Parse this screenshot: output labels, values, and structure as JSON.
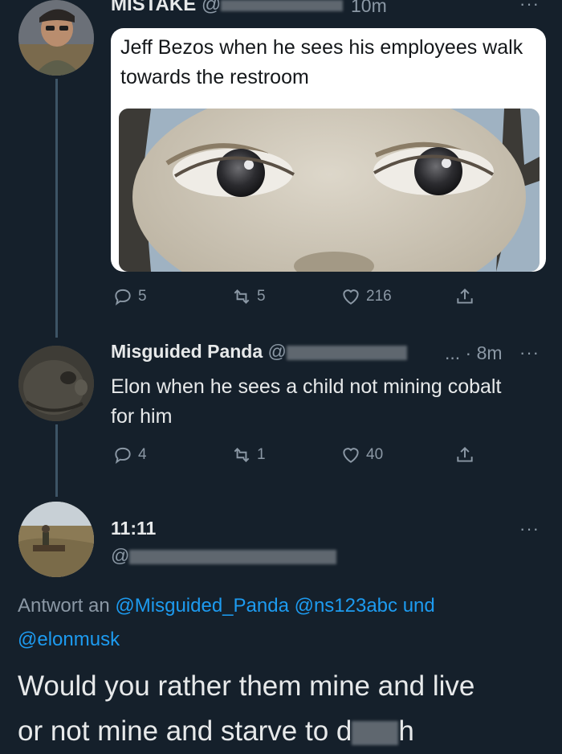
{
  "tweets": [
    {
      "name": "MISTAKE",
      "handle": "@",
      "time": "10m",
      "more": "···",
      "caption": "Jeff Bezos when he sees his employees walk towards the restroom",
      "actions": {
        "reply": "5",
        "retweet": "5",
        "like": "216"
      }
    },
    {
      "name": "Misguided Panda",
      "handle": "@",
      "time": "... · 8m",
      "more": "···",
      "text": "Elon when he sees a child not mining cobalt for him",
      "actions": {
        "reply": "4",
        "retweet": "1",
        "like": "40"
      }
    }
  ],
  "main": {
    "name": "11:11",
    "handle": "@",
    "more": "···",
    "reply_to_prefix": "Antwort an",
    "reply_to_users": "@Misguided_Panda @ns123abc und",
    "reply_to_users_2": "@elonmusk",
    "text_line1": "Would you rather them mine and live",
    "text_line2_start": "or not mine and starve to d",
    "text_line2_end": "h"
  },
  "colors": {
    "background": "#15202b",
    "accent": "#1d9bf0",
    "muted": "#8b98a5",
    "text": "#e7e9ea"
  }
}
